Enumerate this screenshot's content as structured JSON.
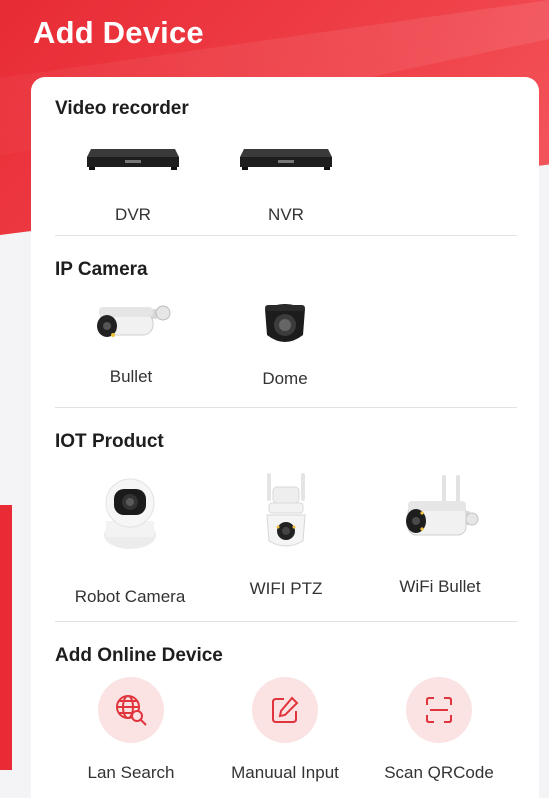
{
  "header": {
    "title": "Add Device"
  },
  "sections": {
    "video_recorder": {
      "title": "Video recorder",
      "items": [
        {
          "label": "DVR",
          "icon": "dvr-icon"
        },
        {
          "label": "NVR",
          "icon": "nvr-icon"
        }
      ]
    },
    "ip_camera": {
      "title": "IP Camera",
      "items": [
        {
          "label": "Bullet",
          "icon": "bullet-camera-icon"
        },
        {
          "label": "Dome",
          "icon": "dome-camera-icon"
        }
      ]
    },
    "iot_product": {
      "title": "IOT Product",
      "items": [
        {
          "label": "Robot Camera",
          "icon": "robot-camera-icon"
        },
        {
          "label": "WIFI PTZ",
          "icon": "wifi-ptz-camera-icon"
        },
        {
          "label": "WiFi Bullet",
          "icon": "wifi-bullet-camera-icon"
        }
      ]
    },
    "online": {
      "title": "Add Online Device",
      "items": [
        {
          "label": "Lan Search",
          "icon": "globe-search-icon"
        },
        {
          "label": "Manuual Input",
          "icon": "edit-icon"
        },
        {
          "label": "Scan QRCode",
          "icon": "scan-icon"
        }
      ]
    }
  },
  "colors": {
    "brand_red": "#e82b35",
    "icon_bg": "#fbe3e3",
    "icon_stroke": "#e0353d"
  }
}
